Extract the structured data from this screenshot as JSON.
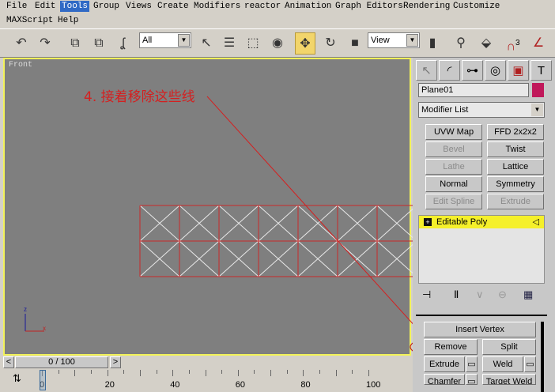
{
  "menu": {
    "items": [
      "File",
      "Edit",
      "Tools",
      "Group",
      "Views",
      "Create",
      "Modifiers",
      "reactor",
      "Animation",
      "Graph Editors",
      "Rendering",
      "Customize",
      "MAXScript",
      "Help"
    ],
    "active": "Tools"
  },
  "toolbar": {
    "selection_filter": "All",
    "reference_coord": "View",
    "snap_label": "3"
  },
  "viewport": {
    "label": "Front",
    "annotation": "4. 接着移除这些线",
    "axis_z": "z",
    "axis_x": "x",
    "wire_color": "#c82828",
    "annotation_color": "#d42020"
  },
  "command_panel": {
    "object_name": "Plane01",
    "object_color": "#c0185a",
    "modifier_list": "Modifier List",
    "modifier_buttons": [
      {
        "label": "UVW Map",
        "enabled": true
      },
      {
        "label": "FFD 2x2x2",
        "enabled": true
      },
      {
        "label": "Bevel",
        "enabled": false
      },
      {
        "label": "Twist",
        "enabled": true
      },
      {
        "label": "Lathe",
        "enabled": false
      },
      {
        "label": "Lattice",
        "enabled": true
      },
      {
        "label": "Normal",
        "enabled": true
      },
      {
        "label": "Symmetry",
        "enabled": true
      },
      {
        "label": "Edit Spline",
        "enabled": false
      },
      {
        "label": "Extrude",
        "enabled": false
      }
    ],
    "stack_item": "Editable Poly",
    "edit_buttons": {
      "insert_vertex": "Insert Vertex",
      "remove": "Remove",
      "split": "Split",
      "extrude": "Extrude",
      "weld": "Weld",
      "chamfer": "Chamfer",
      "target_weld": "Target Weld"
    }
  },
  "timeline": {
    "frame_display": "0 / 100",
    "prev": "<",
    "next": ">",
    "ticks": [
      "0",
      "20",
      "40",
      "60",
      "80",
      "100"
    ]
  }
}
